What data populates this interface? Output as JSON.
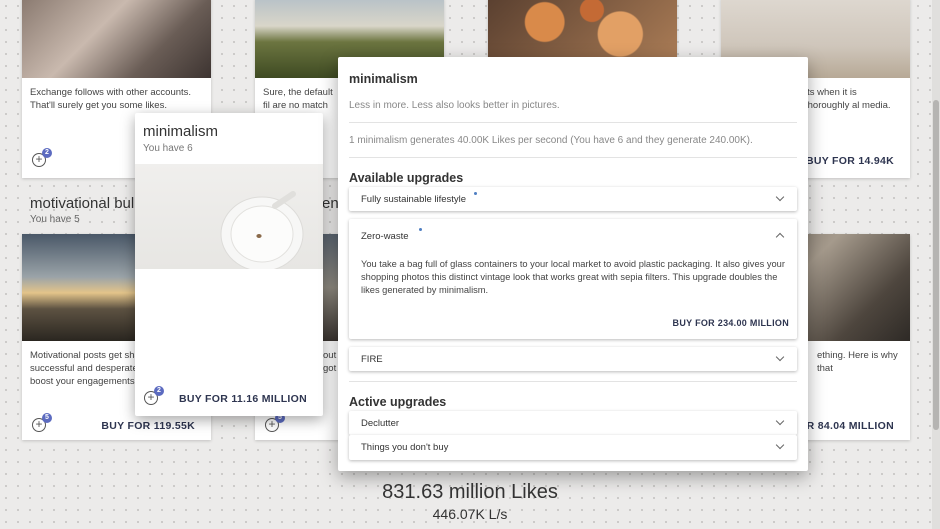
{
  "top_cards": [
    {
      "desc": "Exchange follows with other accounts. That'll surely get you some likes.",
      "buy": ""
    },
    {
      "desc": "Sure, the default fil are no match for the up s",
      "buy": ""
    },
    {
      "desc": "",
      "buy": ""
    },
    {
      "desc": "its when it is thoroughly al media.",
      "buy": "BUY FOR 14.94K"
    }
  ],
  "top_badges": [
    "2"
  ],
  "motivational": {
    "title": "motivational bul",
    "owned": "You have 5",
    "desc": "Motivational posts get sha successful and desperate boost your engagements.",
    "buy": "BUY FOR 119.55K",
    "badge": "5"
  },
  "row2_mid": {
    "title_frag": "ene",
    "desc": "out got",
    "badge": "5"
  },
  "row2_right": {
    "desc": "ething. Here is why that",
    "buy": "R 84.04 MILLION"
  },
  "small_card": {
    "title": "minimalism",
    "owned": "You have 6",
    "buy": "BUY FOR 11.16 MILLION",
    "badge": "2"
  },
  "modal": {
    "title": "minimalism",
    "tagline": "Less in more. Less also looks better in pictures.",
    "rate_info": "1 minimalism generates 40.00K Likes per second (You have 6 and they generate 240.00K).",
    "available_heading": "Available upgrades",
    "available": [
      {
        "label": "Fully sustainable lifestyle",
        "expanded": false
      },
      {
        "label": "Zero-waste",
        "expanded": true,
        "desc": "You take a bag full of glass containers to your local market to avoid plastic packaging. It also gives your shopping photos this distinct vintage look that works great with sepia filters. This upgrade doubles the likes generated by minimalism.",
        "buy": "BUY FOR 234.00 MILLION"
      },
      {
        "label": "FIRE",
        "expanded": false
      }
    ],
    "active_heading": "Active upgrades",
    "active": [
      {
        "label": "Declutter"
      },
      {
        "label": "Things you don't buy"
      }
    ]
  },
  "footer": {
    "likes": "831.63 million Likes",
    "rate": "446.07K L/s"
  },
  "colors": {
    "accent": "#5c6bc0",
    "button_text": "#2e3550"
  }
}
